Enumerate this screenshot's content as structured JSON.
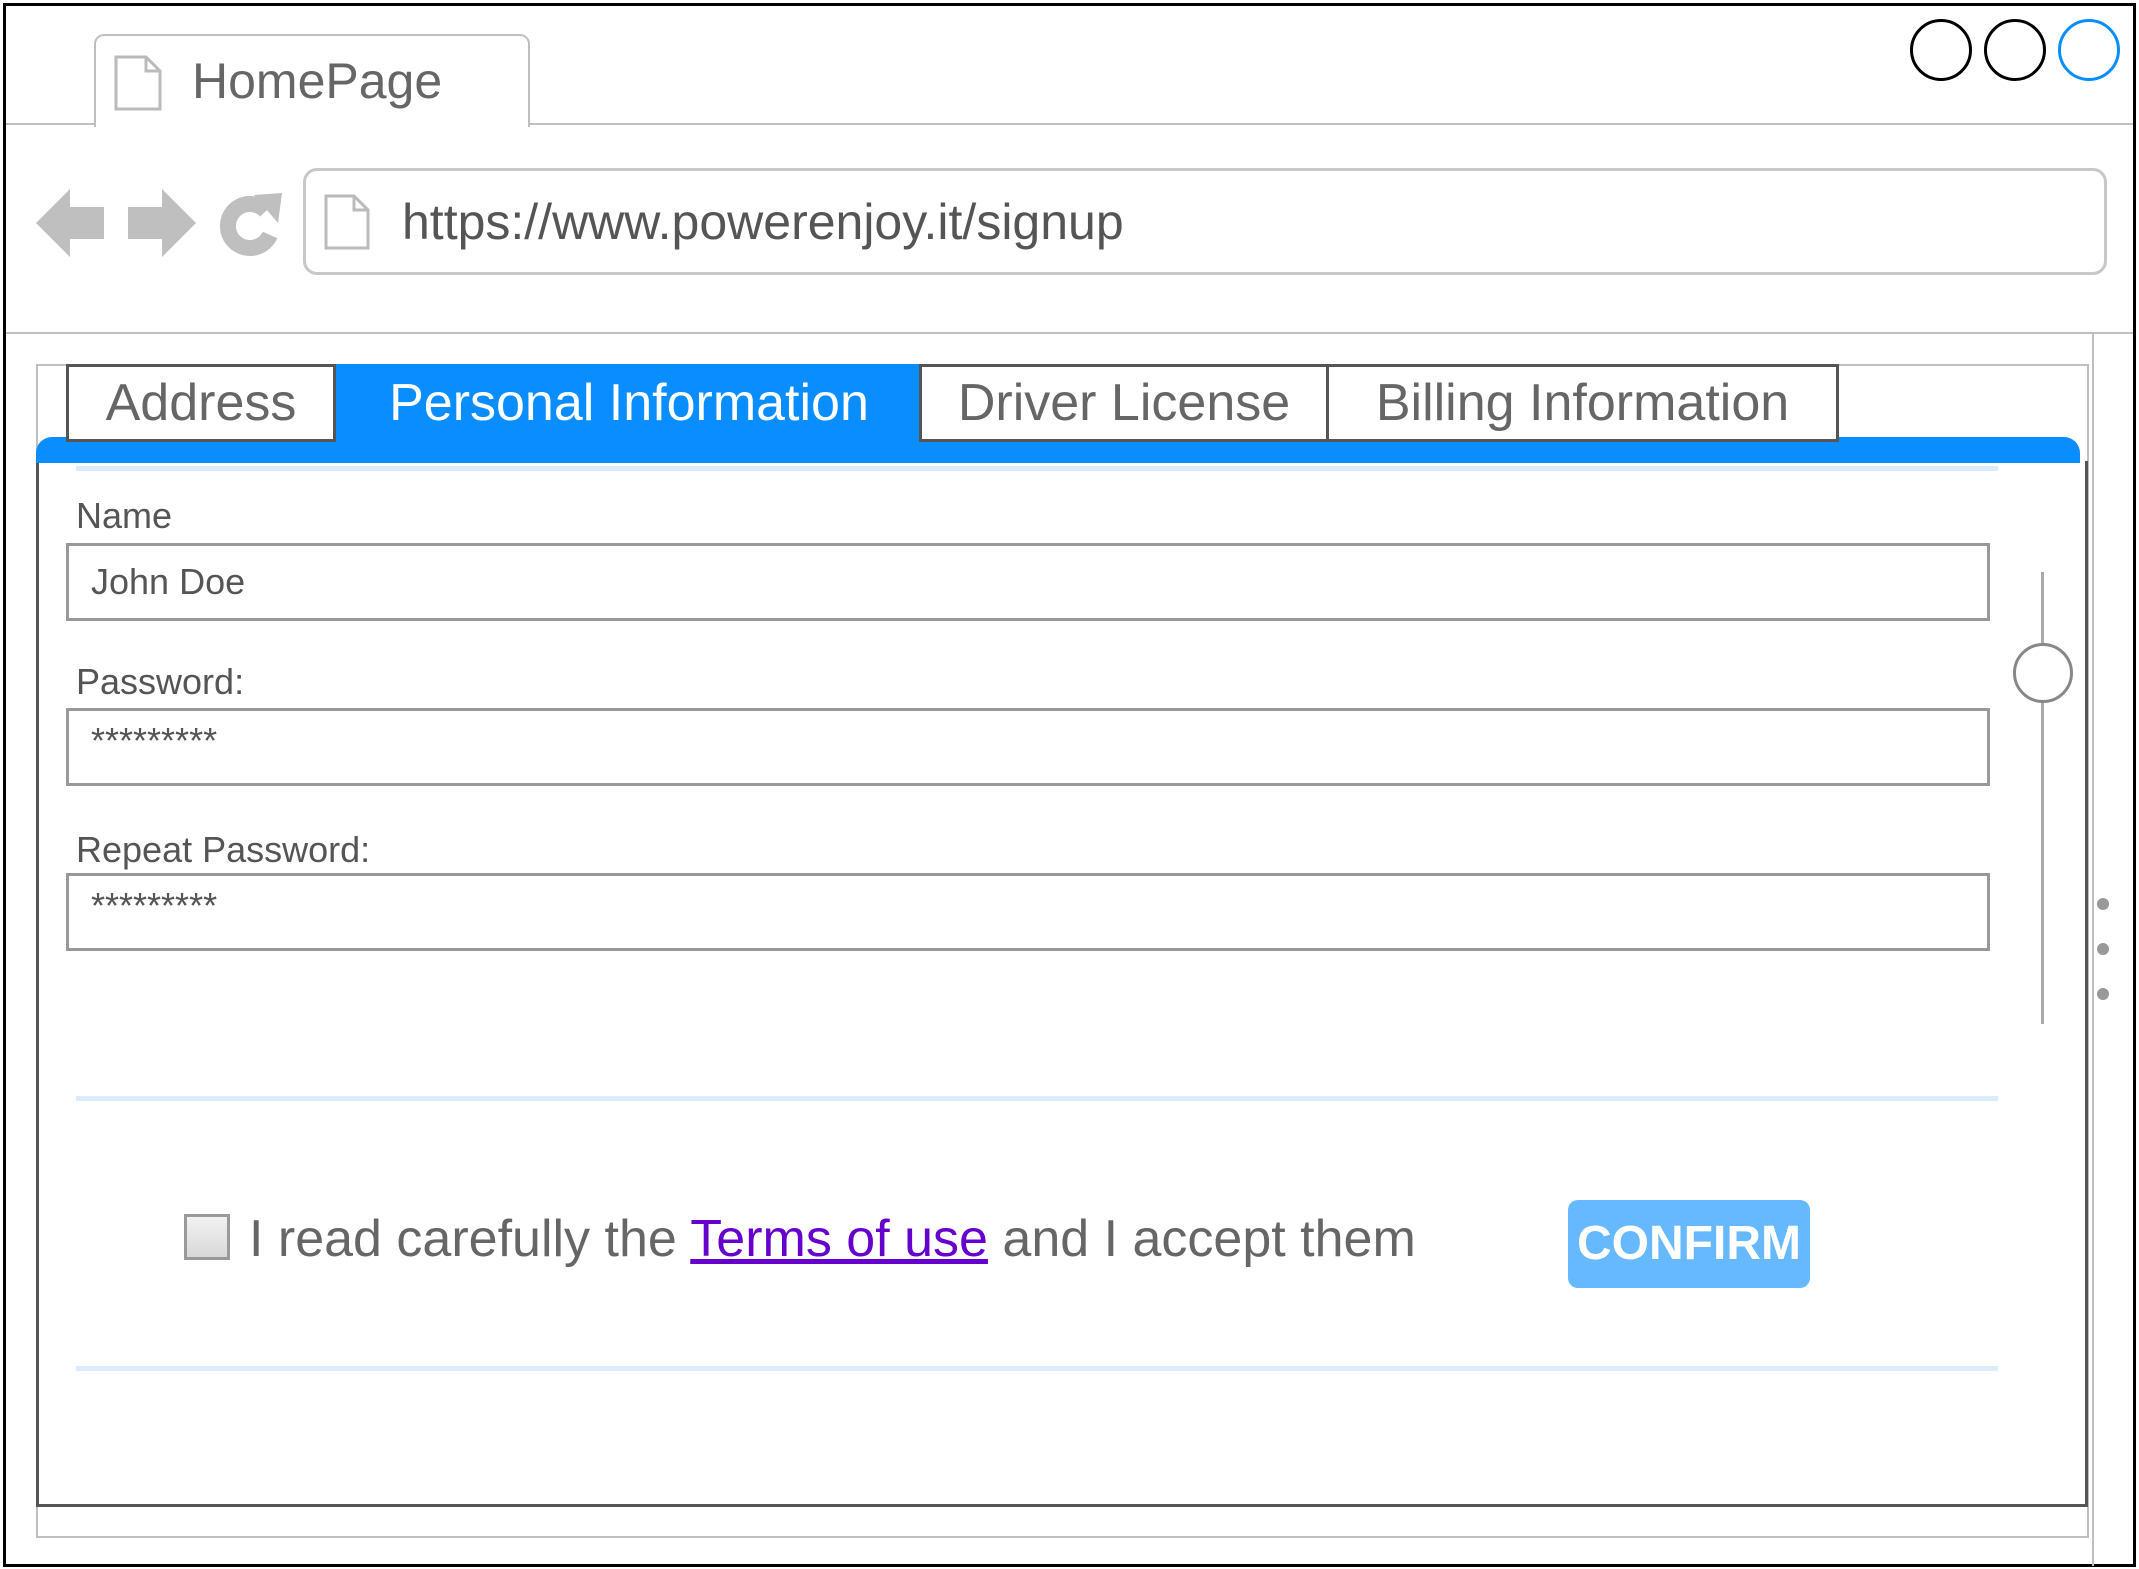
{
  "browser": {
    "tab_title": "HomePage",
    "url": "https://www.powerenjoy.it/signup",
    "window_buttons": [
      "minimize",
      "maximize",
      "close"
    ],
    "nav_icons": [
      "back-arrow-icon",
      "forward-arrow-icon",
      "reload-icon"
    ]
  },
  "tabs": [
    {
      "label": "Address",
      "active": false
    },
    {
      "label": "Personal Information",
      "active": true
    },
    {
      "label": "Driver License",
      "active": false
    },
    {
      "label": "Billing Information",
      "active": false
    }
  ],
  "form": {
    "name_label": "Name",
    "name_value": "John Doe",
    "password_label": "Password:",
    "password_value": "*********",
    "repeat_password_label": "Repeat Password:",
    "repeat_password_value": "*********"
  },
  "terms": {
    "prefix": "I read carefully the",
    "link": "Terms of use",
    "suffix": "and I accept them"
  },
  "confirm_label": "CONFIRM",
  "colors": {
    "accent": "#0a8eff",
    "button": "#66b8ff",
    "link": "#6600cc",
    "window_close_ring": "#0a8eff"
  }
}
